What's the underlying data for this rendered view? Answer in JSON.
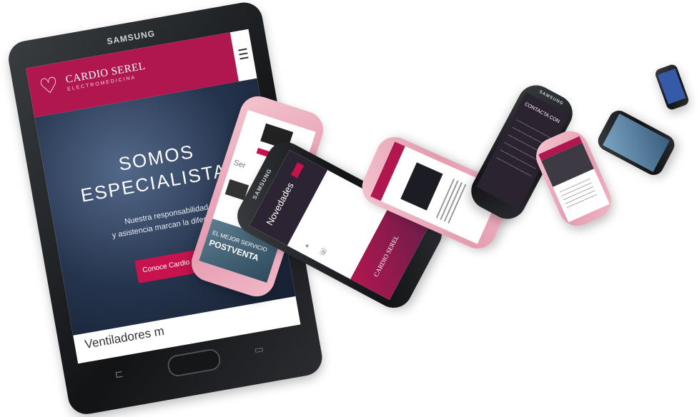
{
  "main_phone": {
    "brand": "SAMSUNG",
    "logo_name": "CARDIO SEREL",
    "logo_tagline": "ELECTROMEDICINA",
    "hero_title_line1": "SOMOS",
    "hero_title_line2": "ESPECIALISTAS",
    "hero_subtitle_line1": "Nuestra responsabilidad",
    "hero_subtitle_line2": "y asistencia marcan la diferencia",
    "hero_button": "Conoce Cardio Serel",
    "section_title": "Ventiladores m"
  },
  "pink_phone_2": {
    "banner_line1": "EL MEJOR SERVICIO",
    "banner_line2": "POSTVENTA",
    "partial_text": "Ser"
  },
  "black_phone_3": {
    "brand": "SAMSUNG",
    "heading": "Novedades",
    "logo_name": "CARDIO SEREL"
  },
  "black_phone_5": {
    "brand": "SAMSUNG",
    "heading": "CONTACTA CON"
  },
  "colors": {
    "brand_primary": "#b0174f",
    "hero_dark": "#25344d",
    "pink_phone": "#e9a3b6",
    "black_phone": "#1b1d1f"
  }
}
